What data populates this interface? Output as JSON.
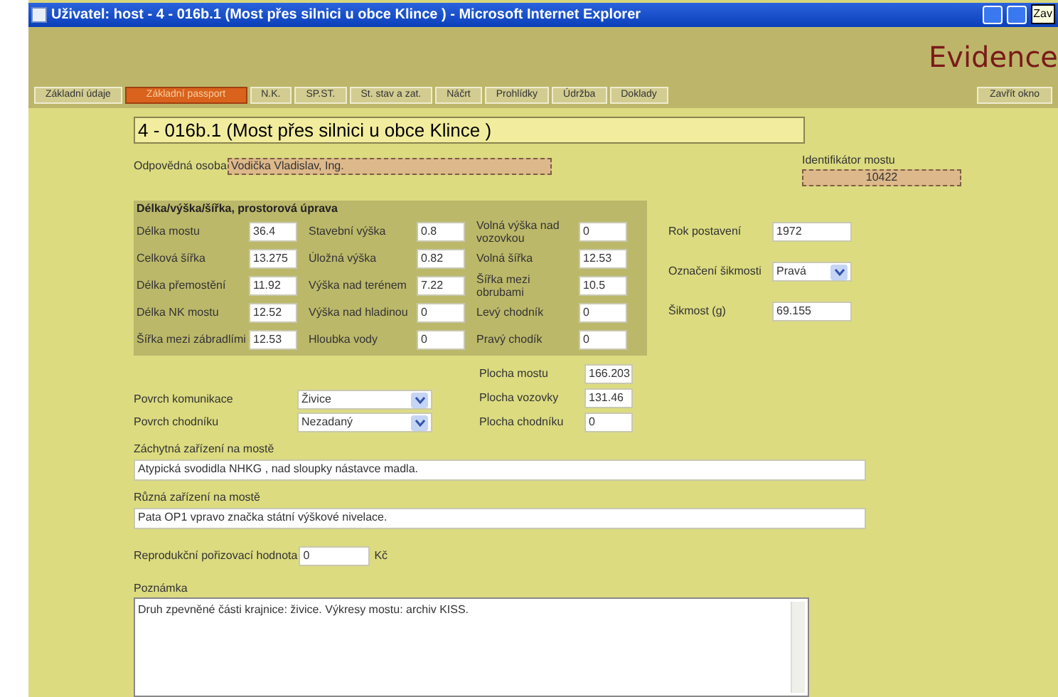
{
  "window": {
    "title": "Uživatel: host - 4 - 016b.1 (Most přes silnici u obce Klince ) - Microsoft Internet Explorer",
    "tooltip": "Zav"
  },
  "header": {
    "brand": "Evidence"
  },
  "tabs": [
    {
      "label": "Základní údaje",
      "selected": false
    },
    {
      "label": "Základní passport",
      "selected": true
    },
    {
      "label": "N.K.",
      "selected": false
    },
    {
      "label": "SP.ST.",
      "selected": false
    },
    {
      "label": "St. stav a zat.",
      "selected": false
    },
    {
      "label": "Náčrt",
      "selected": false
    },
    {
      "label": "Prohlídky",
      "selected": false
    },
    {
      "label": "Údržba",
      "selected": false
    },
    {
      "label": "Doklady",
      "selected": false
    }
  ],
  "close_button": "Zavřít okno",
  "bridge_title": "4 - 016b.1 (Most přes silnici u obce Klince )",
  "responsible": {
    "label": "Odpovědná osoba",
    "value": "Vodička Vladislav, Ing."
  },
  "bridge_id": {
    "label": "Identifikátor mostu",
    "value": "10422"
  },
  "dimensions": {
    "title": "Délka/výška/šířka, prostorová úprava",
    "rows": [
      [
        {
          "label": "Délka mostu",
          "value": "36.4"
        },
        {
          "label": "Stavební výška",
          "value": "0.8"
        },
        {
          "label": "Volná výška nad vozovkou",
          "value": "0"
        }
      ],
      [
        {
          "label": "Celková šířka",
          "value": "13.275"
        },
        {
          "label": "Úložná výška",
          "value": "0.82"
        },
        {
          "label": "Volná šířka",
          "value": "12.53"
        }
      ],
      [
        {
          "label": "Délka přemostění",
          "value": "11.92"
        },
        {
          "label": "Výška nad terénem",
          "value": "7.22"
        },
        {
          "label": "Šířka mezi obrubami",
          "value": "10.5"
        }
      ],
      [
        {
          "label": "Délka NK mostu",
          "value": "12.52"
        },
        {
          "label": "Výška nad hladinou",
          "value": "0"
        },
        {
          "label": "Levý chodník",
          "value": "0"
        }
      ],
      [
        {
          "label": "Šířka mezi zábradlími",
          "value": "12.53"
        },
        {
          "label": "Hloubka vody",
          "value": "0"
        },
        {
          "label": "Pravý chodík",
          "value": "0"
        }
      ]
    ]
  },
  "side_fields": [
    {
      "kind": "input",
      "label": "Rok postavení",
      "value": "1972"
    },
    {
      "kind": "select",
      "label": "Označení šikmosti",
      "value": "Pravá"
    },
    {
      "kind": "input",
      "label": "Šikmost (g)",
      "value": "69.155"
    }
  ],
  "surfaces": [
    {
      "label": "Povrch komunikace",
      "value": "Živice"
    },
    {
      "label": "Povrch chodníku",
      "value": "Nezadaný"
    }
  ],
  "areas": [
    {
      "label": "Plocha mostu",
      "value": "166.203"
    },
    {
      "label": "Plocha vozovky",
      "value": "131.46"
    },
    {
      "label": "Plocha chodníku",
      "value": "0"
    }
  ],
  "safety": {
    "label": "Záchytná zařízení na mostě",
    "value": "Atypická svodidla NHKG , nad sloupky nástavce madla."
  },
  "equipment": {
    "label": "Různá zařízení na mostě",
    "value": "Pata OP1 vpravo značka státní výškové nivelace."
  },
  "cost": {
    "label": "Reprodukční pořizovací hodnota",
    "value": "0",
    "unit": "Kč"
  },
  "note": {
    "label": "Poznámka",
    "value": "Druh zpevněné části krajnice: živice. Výkresy mostu: archiv KISS."
  }
}
